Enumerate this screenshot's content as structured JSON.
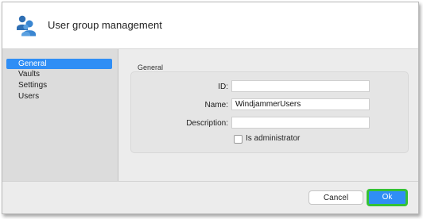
{
  "dialog": {
    "title": "User group management",
    "header_icon": "users-group-icon"
  },
  "sidebar": {
    "items": [
      {
        "label": "General",
        "selected": true
      },
      {
        "label": "Vaults",
        "selected": false
      },
      {
        "label": "Settings",
        "selected": false
      },
      {
        "label": "Users",
        "selected": false
      }
    ]
  },
  "general": {
    "group_title": "General",
    "id_label": "ID:",
    "id_value": "",
    "name_label": "Name:",
    "name_value": "WindjammerUsers",
    "description_label": "Description:",
    "description_value": "",
    "is_admin_label": "Is administrator",
    "is_admin_checked": false
  },
  "footer": {
    "cancel_label": "Cancel",
    "ok_label": "Ok"
  },
  "colors": {
    "accent": "#2f8ef5",
    "highlight_border": "#35c235"
  }
}
